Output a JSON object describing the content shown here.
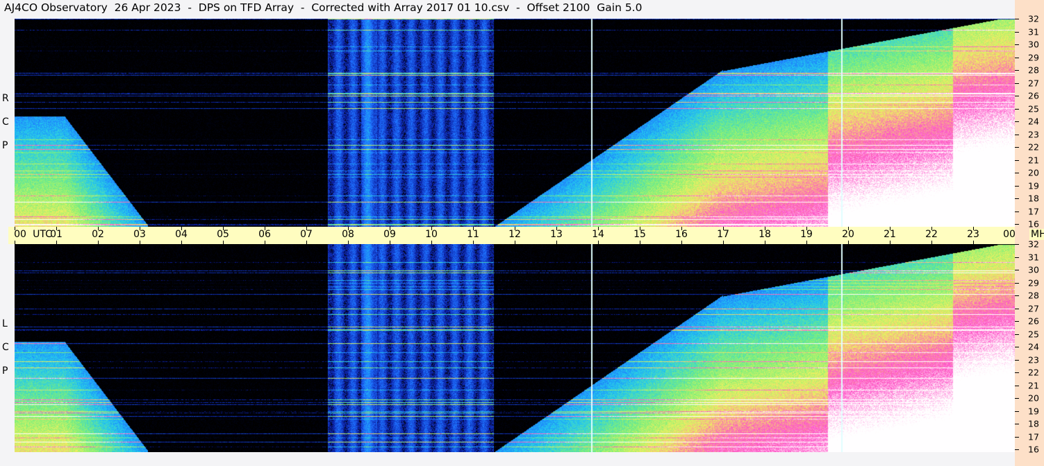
{
  "title": "AJ4CO Observatory  26 Apr 2023  -  DPS on TFD Array  -  Corrected with Array 2017 01 10.csv  -  Offset 2100  Gain 5.0",
  "chart_data": {
    "type": "heatmap",
    "title": "AJ4CO Observatory  26 Apr 2023  -  DPS on TFD Array  -  Corrected with Array 2017 01 10.csv  -  Offset 2100  Gain 5.0",
    "panels": [
      {
        "name": "RCP",
        "letters": [
          "R",
          "C",
          "P"
        ]
      },
      {
        "name": "LCP",
        "letters": [
          "L",
          "C",
          "P"
        ]
      }
    ],
    "x_axis": {
      "label": "UTC",
      "range": [
        0,
        24
      ],
      "tick_labels": [
        "00",
        "01",
        "02",
        "03",
        "04",
        "05",
        "06",
        "07",
        "08",
        "09",
        "10",
        "11",
        "12",
        "13",
        "14",
        "15",
        "16",
        "17",
        "18",
        "19",
        "20",
        "21",
        "22",
        "23",
        "00"
      ]
    },
    "y_axis": {
      "unit": "MHz",
      "range": [
        16,
        32
      ],
      "tick_labels": [
        "16",
        "17",
        "18",
        "19",
        "20",
        "21",
        "22",
        "23",
        "24",
        "25",
        "26",
        "27",
        "28",
        "29",
        "30",
        "31",
        "32"
      ]
    },
    "colormap": [
      "#000000",
      "#0a1a9a",
      "#1e6cff",
      "#22c8f0",
      "#7cf07a",
      "#f0f060",
      "#ff50c8",
      "#ffffff"
    ],
    "vertical_markers_utc": [
      13.83,
      19.83
    ],
    "features": "intensity rises with ionospheric cutoff; bright band 08-11 UTC"
  }
}
